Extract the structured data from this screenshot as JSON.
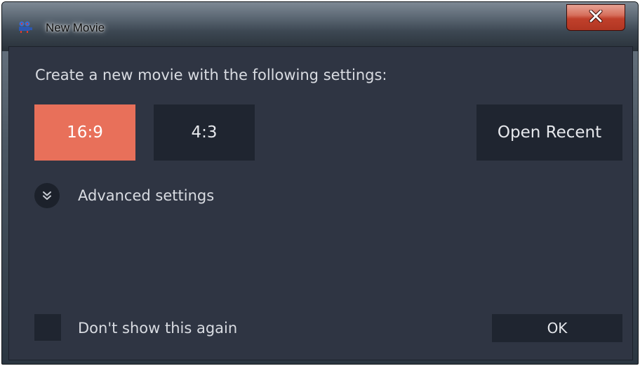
{
  "window": {
    "title": "New Movie",
    "app_icon": "film-reel-icon",
    "close_icon": "close-icon",
    "close_button_color": "#c0402b"
  },
  "dialog": {
    "prompt": "Create a new movie with the following settings:",
    "aspect_buttons": [
      {
        "label": "16:9",
        "selected": true
      },
      {
        "label": "4:3",
        "selected": false
      }
    ],
    "open_recent_label": "Open Recent",
    "advanced": {
      "icon": "double-chevron-down-icon",
      "label": "Advanced  settings",
      "expanded": false
    },
    "dont_show_again": {
      "label": "Don't show this again",
      "checked": false
    },
    "ok_label": "OK"
  },
  "colors": {
    "accent": "#e8705a",
    "panel_bg": "#2f3543",
    "button_bg": "#1f2530",
    "text": "#d9dce2"
  }
}
